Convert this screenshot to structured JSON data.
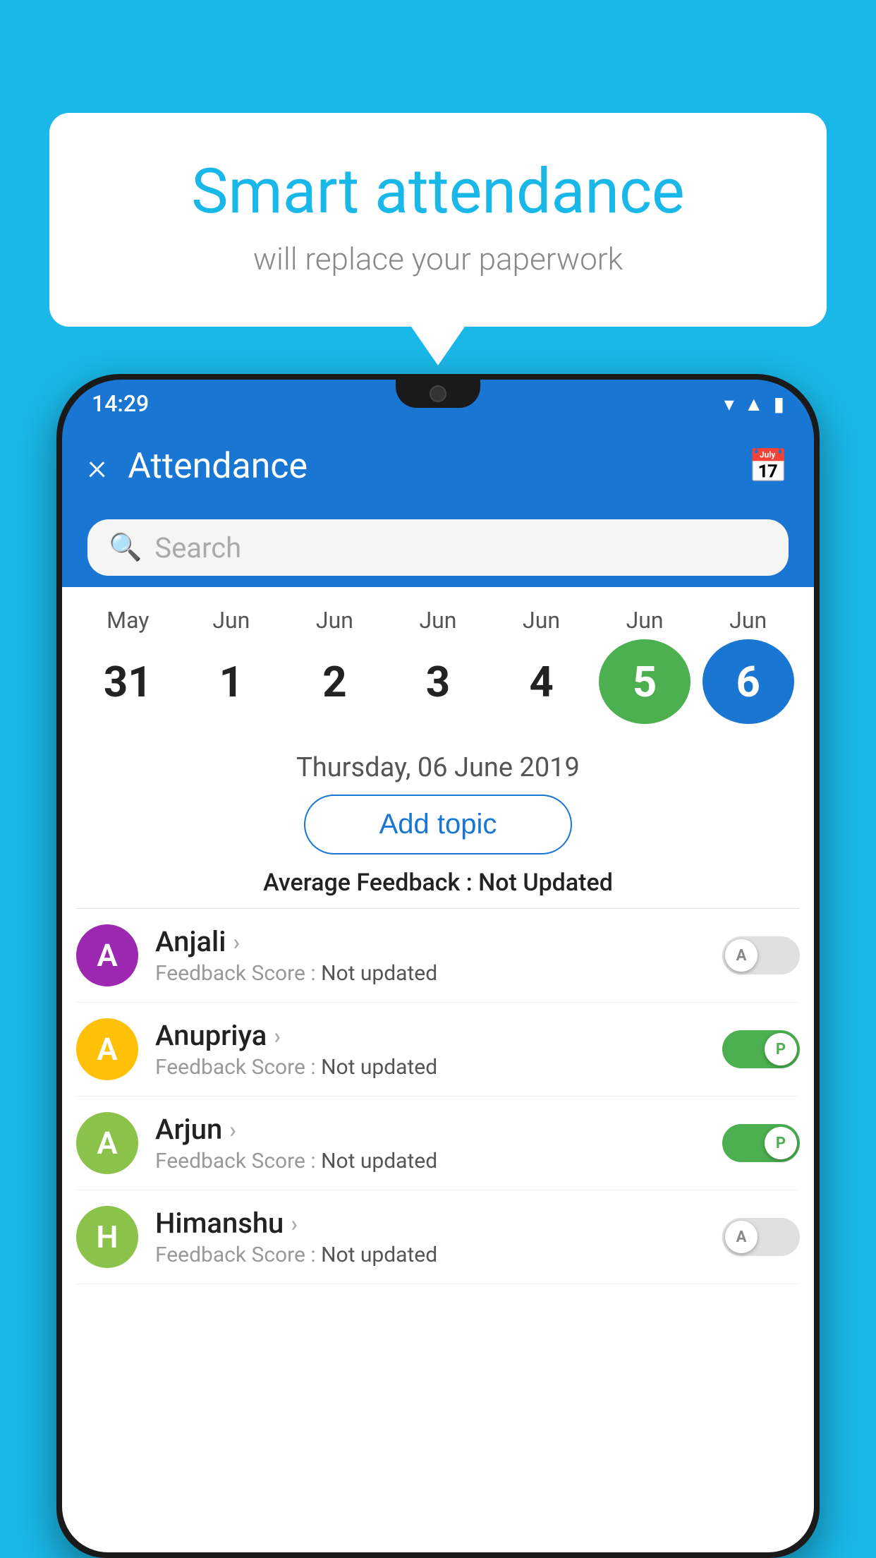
{
  "background_color": "#1AB8E8",
  "bubble": {
    "title": "Smart attendance",
    "subtitle": "will replace your paperwork"
  },
  "status_bar": {
    "time": "14:29",
    "icons": [
      "wifi",
      "signal",
      "battery"
    ]
  },
  "app_bar": {
    "title": "Attendance",
    "close_label": "×",
    "calendar_label": "📅"
  },
  "search": {
    "placeholder": "Search"
  },
  "calendar": {
    "months": [
      "May",
      "Jun",
      "Jun",
      "Jun",
      "Jun",
      "Jun",
      "Jun"
    ],
    "dates": [
      "31",
      "1",
      "2",
      "3",
      "4",
      "5",
      "6"
    ],
    "today_index": 5,
    "selected_index": 6
  },
  "date_label": "Thursday, 06 June 2019",
  "add_topic_label": "Add topic",
  "avg_feedback_label": "Average Feedback :",
  "avg_feedback_value": "Not Updated",
  "students": [
    {
      "name": "Anjali",
      "avatar_letter": "A",
      "avatar_color": "#9C27B0",
      "feedback_label": "Feedback Score :",
      "feedback_value": "Not updated",
      "toggle_state": "off",
      "toggle_letter": "A"
    },
    {
      "name": "Anupriya",
      "avatar_letter": "A",
      "avatar_color": "#FFC107",
      "feedback_label": "Feedback Score :",
      "feedback_value": "Not updated",
      "toggle_state": "on",
      "toggle_letter": "P"
    },
    {
      "name": "Arjun",
      "avatar_letter": "A",
      "avatar_color": "#8BC34A",
      "feedback_label": "Feedback Score :",
      "feedback_value": "Not updated",
      "toggle_state": "on",
      "toggle_letter": "P"
    },
    {
      "name": "Himanshu",
      "avatar_letter": "H",
      "avatar_color": "#8BC34A",
      "feedback_label": "Feedback Score :",
      "feedback_value": "Not updated",
      "toggle_state": "off",
      "toggle_letter": "A"
    }
  ]
}
